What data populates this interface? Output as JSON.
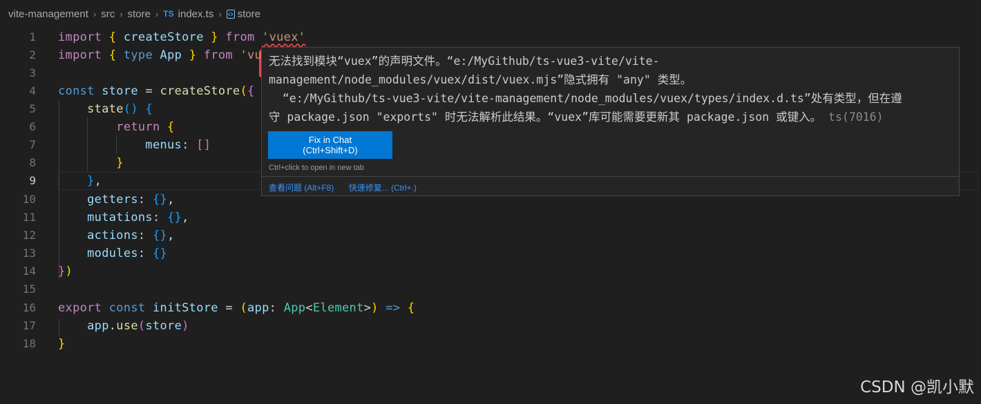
{
  "breadcrumb": {
    "project": "vite-management",
    "folder": "src",
    "subfolder": "store",
    "file_badge": "TS",
    "file": "index.ts",
    "symbol_icon": "symbol-variable-icon",
    "symbol": "store"
  },
  "line_numbers": [
    "1",
    "2",
    "3",
    "4",
    "5",
    "6",
    "7",
    "8",
    "9",
    "10",
    "11",
    "12",
    "13",
    "14",
    "15",
    "16",
    "17",
    "18"
  ],
  "code": {
    "l1": {
      "kw": "import",
      "b1": "{",
      "id": "createStore",
      "b2": "}",
      "from": "from",
      "str": "'vuex'"
    },
    "l2": {
      "kw": "import",
      "b1": "{",
      "ty_kw": "type",
      "id": "App",
      "b2": "}",
      "from": "from",
      "str": "'vu"
    },
    "l4": {
      "kw": "const",
      "id": "store",
      "eq": "=",
      "fn": "createStore",
      "p": "(",
      "b": "{"
    },
    "l5": {
      "fn": "state",
      "p": "()",
      "b": "{"
    },
    "l6": {
      "kw": "return",
      "b": "{"
    },
    "l7": {
      "id": "menus",
      "colon": ":",
      "arr": "[]"
    },
    "l8": {
      "b": "}"
    },
    "l9": {
      "b": "}",
      "comma": ","
    },
    "l10": {
      "id": "getters",
      "rest": ":",
      "b": "{}",
      "comma": ","
    },
    "l11": {
      "id": "mutations",
      "rest": ":",
      "b": "{}",
      "comma": ","
    },
    "l12": {
      "id": "actions",
      "rest": ":",
      "b": "{}",
      "comma": ","
    },
    "l13": {
      "id": "modules",
      "rest": ":",
      "b": "{}"
    },
    "l14": {
      "b": "}",
      "p": ")"
    },
    "l16": {
      "kw": "export",
      "kw2": "const",
      "id": "initStore",
      "eq": "=",
      "p1": "(",
      "arg": "app",
      "colon": ":",
      "ty": "App",
      "lt": "<",
      "ty2": "Element",
      "gt": ">",
      "p2": ")",
      "arrow": "=>",
      "b": "{"
    },
    "l17": {
      "id": "app",
      "dot": ".",
      "fn": "use",
      "p1": "(",
      "arg": "store",
      "p2": ")"
    },
    "l18": {
      "b": "}"
    }
  },
  "hover": {
    "line1": "无法找到模块“vuex”的声明文件。“e:/MyGithub/ts-vue3-vite/vite-",
    "line2": "management/node_modules/vuex/dist/vuex.mjs”隐式拥有 \"any\" 类型。",
    "line3": "  “e:/MyGithub/ts-vue3-vite/vite-management/node_modules/vuex/types/index.d.ts”处有类型，但在遵",
    "line4": "守 package.json \"exports\" 时无法解析此结果。“vuex”库可能需要更新其 package.json 或键入。",
    "error_code": "ts(7016)",
    "fix_button_line1": "Fix in Chat",
    "fix_button_line2": "(Ctrl+Shift+D)",
    "ctrl_hint": "Ctrl+click to open in new tab",
    "action_view_problem": "查看问题 (Alt+F8)",
    "action_quick_fix": "快速修复... (Ctrl+.)"
  },
  "watermark": "CSDN @凯小默",
  "colors": {
    "background": "#1f1f1f",
    "highlight_box": "#e5484d",
    "fix_button": "#0078d4",
    "link": "#3794ff"
  }
}
